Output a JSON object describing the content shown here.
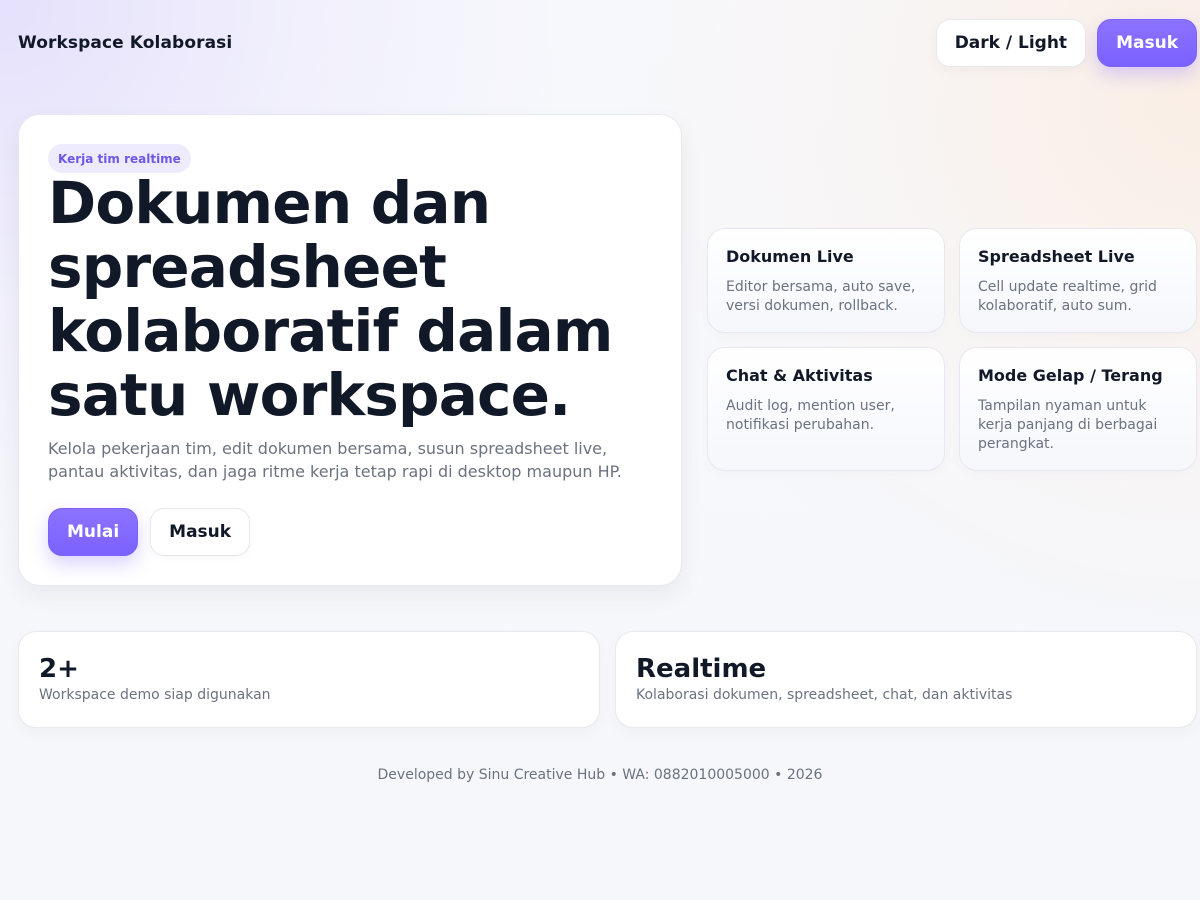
{
  "header": {
    "brand": "Workspace Kolaborasi",
    "theme_toggle_label": "Dark / Light",
    "login_label": "Masuk"
  },
  "hero": {
    "badge": "Kerja tim realtime",
    "title": "Dokumen dan spreadsheet kolaboratif dalam satu workspace.",
    "description": "Kelola pekerjaan tim, edit dokumen bersama, susun spreadsheet live, pantau aktivitas, dan jaga ritme kerja tetap rapi di desktop maupun HP.",
    "primary_button": "Mulai",
    "secondary_button": "Masuk"
  },
  "features": [
    {
      "title": "Dokumen Live",
      "description": "Editor bersama, auto save, versi dokumen, rollback."
    },
    {
      "title": "Spreadsheet Live",
      "description": "Cell update realtime, grid kolaboratif, auto sum."
    },
    {
      "title": "Chat & Aktivitas",
      "description": "Audit log, mention user, notifikasi perubahan."
    },
    {
      "title": "Mode Gelap / Terang",
      "description": "Tampilan nyaman untuk kerja panjang di berbagai perangkat."
    }
  ],
  "stats": [
    {
      "value": "2+",
      "label": "Workspace demo siap digunakan"
    },
    {
      "value": "Realtime",
      "label": "Kolaborasi dokumen, spreadsheet, chat, dan aktivitas"
    }
  ],
  "footer": {
    "text": "Developed by Sinu Creative Hub • WA: 0882010005000 • 2026"
  },
  "colors": {
    "accent": "#7b61ff",
    "text_primary": "#111827",
    "text_secondary": "#6b7280",
    "card_bg": "#ffffff"
  }
}
